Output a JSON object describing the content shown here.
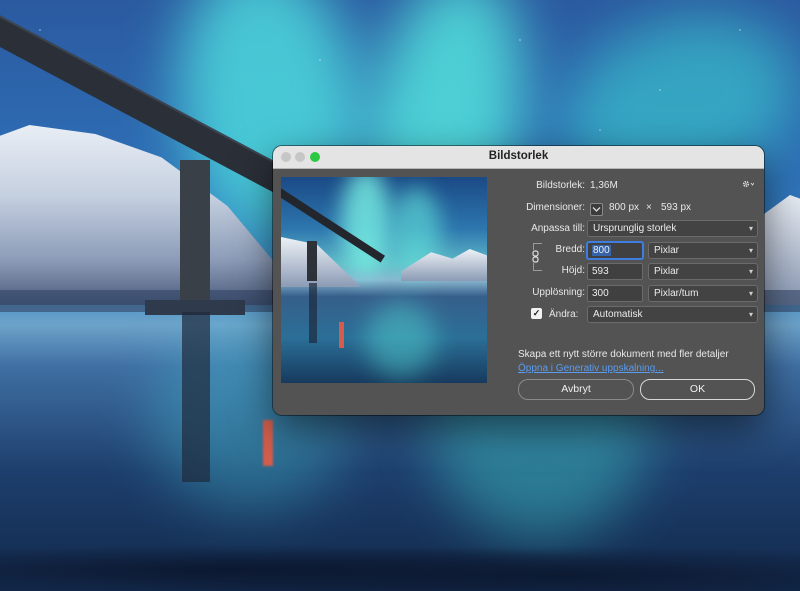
{
  "dialog": {
    "title": "Bildstorlek",
    "image_size_label": "Bildstorlek:",
    "image_size_value": "1,36M",
    "dimensions_label": "Dimensioner:",
    "dimensions_width": "800 px",
    "dimensions_sep": "×",
    "dimensions_height": "593 px",
    "fit_to_label": "Anpassa till:",
    "fit_to_value": "Ursprunglig storlek",
    "width_label": "Bredd:",
    "width_value": "800",
    "width_unit": "Pixlar",
    "height_label": "Höjd:",
    "height_value": "593",
    "height_unit": "Pixlar",
    "resolution_label": "Upplösning:",
    "resolution_value": "300",
    "resolution_unit": "Pixlar/tum",
    "resample_checked": true,
    "resample_label": "Ändra:",
    "resample_value": "Automatisk",
    "info_text": "Skapa ett nytt större dokument med fler detaljer",
    "link_text": "Öppna i Generativ uppskalning...",
    "cancel_label": "Avbryt",
    "ok_label": "OK"
  },
  "icons": {
    "gear": "gear-icon",
    "chain": "link-chain-icon",
    "dropdown": "chevron-down-icon",
    "check": "checkmark-icon"
  },
  "colors": {
    "dialog_bg": "#535353",
    "titlebar_bg": "#e4e4e4",
    "zoom_button": "#2cc841",
    "focus_ring": "#3d7ee0",
    "link": "#5a9cf0"
  }
}
